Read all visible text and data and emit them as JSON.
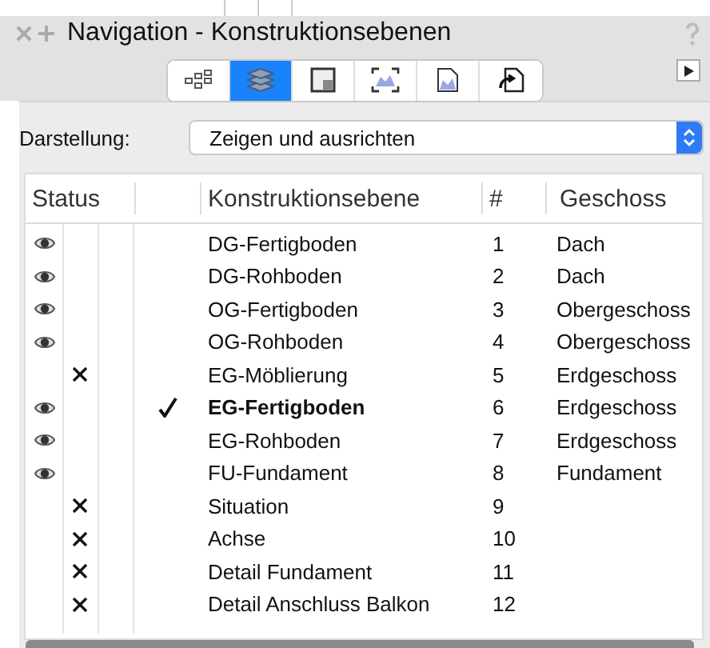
{
  "window": {
    "title": "Navigation - Konstruktionsebenen"
  },
  "tabs": [
    {
      "kind": "tree",
      "selected": false
    },
    {
      "kind": "layers",
      "selected": true
    },
    {
      "kind": "plan",
      "selected": false
    },
    {
      "kind": "view",
      "selected": false
    },
    {
      "kind": "sheet",
      "selected": false
    },
    {
      "kind": "export",
      "selected": false
    }
  ],
  "display": {
    "label": "Darstellung:",
    "value": "Zeigen und ausrichten"
  },
  "table": {
    "columns": [
      "Status",
      "Konstruktionsebene",
      "#",
      "Geschoss"
    ],
    "rows": [
      {
        "visible": true,
        "active": false,
        "name": "DG-Fertigboden",
        "number": "1",
        "story": "Dach"
      },
      {
        "visible": true,
        "active": false,
        "name": "DG-Rohboden",
        "number": "2",
        "story": "Dach"
      },
      {
        "visible": true,
        "active": false,
        "name": "OG-Fertigboden",
        "number": "3",
        "story": "Obergeschoss"
      },
      {
        "visible": true,
        "active": false,
        "name": "OG-Rohboden",
        "number": "4",
        "story": "Obergeschoss"
      },
      {
        "visible": false,
        "active": false,
        "name": "EG-Möblierung",
        "number": "5",
        "story": "Erdgeschoss"
      },
      {
        "visible": true,
        "active": true,
        "name": "EG-Fertigboden",
        "number": "6",
        "story": "Erdgeschoss"
      },
      {
        "visible": true,
        "active": false,
        "name": "EG-Rohboden",
        "number": "7",
        "story": "Erdgeschoss"
      },
      {
        "visible": true,
        "active": false,
        "name": "FU-Fundament",
        "number": "8",
        "story": "Fundament"
      },
      {
        "visible": false,
        "active": false,
        "name": "Situation",
        "number": "9"
      },
      {
        "visible": false,
        "active": false,
        "name": "Achse",
        "number": "10"
      },
      {
        "visible": false,
        "active": false,
        "name": "Detail Fundament",
        "number": "11"
      },
      {
        "visible": false,
        "active": false,
        "name": "Detail Anschluss Balkon",
        "number": "12"
      }
    ]
  }
}
